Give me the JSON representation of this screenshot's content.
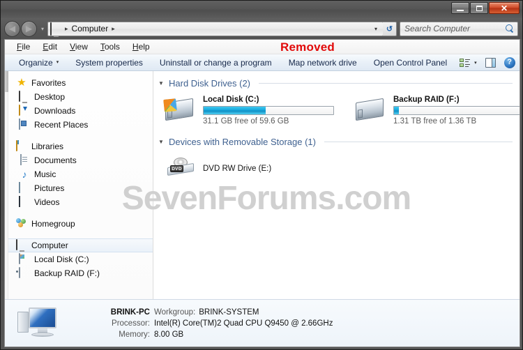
{
  "window": {
    "caption_buttons": {
      "minimize": "minimize-button",
      "maximize": "maximize-button",
      "close": "close-button"
    }
  },
  "address": {
    "computer_icon": "computer-icon",
    "crumb": "Computer",
    "separator": "▸",
    "dropdown_caret": "▾",
    "refresh_label": "↺",
    "nav_back": "◀",
    "nav_forward": "▶",
    "nav_chevron": "▾"
  },
  "search": {
    "placeholder": "Search Computer",
    "value": "",
    "icon": "search-icon"
  },
  "menubar": {
    "items": [
      {
        "pre": "",
        "key": "F",
        "post": "ile"
      },
      {
        "pre": "",
        "key": "E",
        "post": "dit"
      },
      {
        "pre": "",
        "key": "V",
        "post": "iew"
      },
      {
        "pre": "",
        "key": "T",
        "post": "ools"
      },
      {
        "pre": "",
        "key": "H",
        "post": "elp"
      }
    ],
    "annotation": "Removed"
  },
  "toolbar": {
    "organize": "Organize",
    "organize_caret": "▾",
    "system_properties": "System properties",
    "uninstall": "Uninstall or change a program",
    "map_network_drive": "Map network drive",
    "open_control_panel": "Open Control Panel",
    "views_icon": "view-layout-icon",
    "views_caret": "▾",
    "preview_pane_icon": "preview-pane-icon",
    "help_icon": "help-icon",
    "help_glyph": "?"
  },
  "sidebar": {
    "groups": [
      {
        "name": "Favorites",
        "icon": "star-icon",
        "items": [
          {
            "label": "Desktop",
            "icon": "desktop-monitor-icon"
          },
          {
            "label": "Downloads",
            "icon": "downloads-folder-icon"
          },
          {
            "label": "Recent Places",
            "icon": "recent-places-icon"
          }
        ]
      },
      {
        "name": "Libraries",
        "icon": "libraries-folder-icon",
        "items": [
          {
            "label": "Documents",
            "icon": "documents-icon"
          },
          {
            "label": "Music",
            "icon": "music-note-icon"
          },
          {
            "label": "Pictures",
            "icon": "pictures-icon"
          },
          {
            "label": "Videos",
            "icon": "videos-film-icon"
          }
        ]
      },
      {
        "name": "Homegroup",
        "icon": "homegroup-icon",
        "items": []
      },
      {
        "name": "Computer",
        "icon": "computer-icon",
        "selected": true,
        "items": [
          {
            "label": "Local Disk (C:)",
            "icon": "hard-disk-windows-icon"
          },
          {
            "label": "Backup RAID (F:)",
            "icon": "hard-disk-icon"
          }
        ]
      }
    ]
  },
  "content": {
    "sections": [
      {
        "title": "Hard Disk Drives (2)",
        "arrow": "◢",
        "drives": [
          {
            "name": "Local Disk (C:)",
            "capacity_text": "31.1 GB free of 59.6 GB",
            "free_gb": 31.1,
            "total_gb": 59.6,
            "used_percent": 48,
            "icon": "hard-disk-windows-icon"
          },
          {
            "name": "Backup RAID (F:)",
            "capacity_text": "1.31 TB free of 1.36 TB",
            "free_tb": 1.31,
            "total_tb": 1.36,
            "used_percent": 4,
            "icon": "hard-disk-icon"
          }
        ]
      },
      {
        "title": "Devices with Removable Storage (1)",
        "arrow": "◢",
        "devices": [
          {
            "name": "DVD RW Drive (E:)",
            "icon": "dvd-drive-icon",
            "badge": "DVD"
          }
        ]
      }
    ]
  },
  "watermark": "SevenForums.com",
  "statusbar": {
    "icon": "computer-large-icon",
    "pc_name": "BRINK-PC",
    "rows": [
      {
        "label": "Workgroup:",
        "value": "BRINK-SYSTEM"
      },
      {
        "label": "Processor:",
        "value": "Intel(R) Core(TM)2 Quad  CPU   Q9450  @ 2.66GHz"
      },
      {
        "label": "Memory:",
        "value": "8.00 GB"
      }
    ]
  },
  "colors": {
    "accent_blue": "#16a8dd",
    "section_header": "#3f6190",
    "annotation_red": "#e10a0a",
    "watermark_gray": "#d0d0d0"
  }
}
